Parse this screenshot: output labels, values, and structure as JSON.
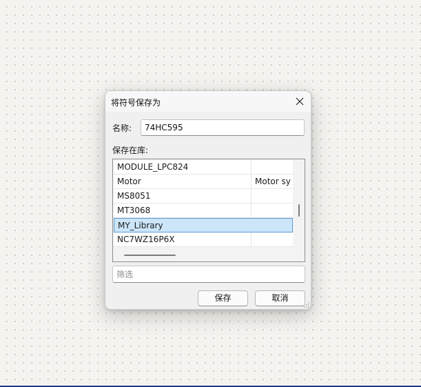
{
  "dialog": {
    "title": "将符号保存为",
    "name_label": "名称:",
    "name_value": "74HC595",
    "library_label": "保存在库:",
    "libraries": [
      {
        "name": "MODULE_LPC824",
        "description": "",
        "selected": false
      },
      {
        "name": "Motor",
        "description": "Motor sy",
        "selected": false
      },
      {
        "name": "MS8051",
        "description": "",
        "selected": false
      },
      {
        "name": "MT3068",
        "description": "",
        "selected": false
      },
      {
        "name": "MY_Library",
        "description": "",
        "selected": true
      },
      {
        "name": "NC7WZ16P6X",
        "description": "",
        "selected": false
      }
    ],
    "filter_placeholder": "筛选",
    "save_label": "保存",
    "cancel_label": "取消"
  },
  "icons": {
    "close": "close-icon",
    "resize": "resize-grip-icon"
  },
  "colors": {
    "selection_bg": "#cce5f8",
    "selection_border": "#5b9bd5",
    "canvas_bg": "#f4f3ef",
    "bottom_edge": "#1f3a8a"
  }
}
